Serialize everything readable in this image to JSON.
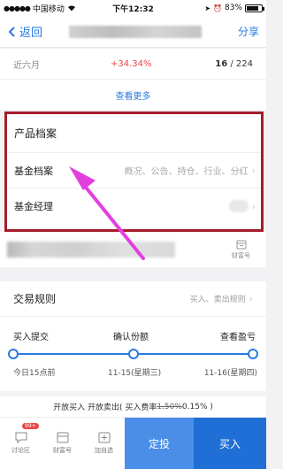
{
  "status": {
    "carrier": "中国移动",
    "time": "下午12:32",
    "battery": "83%",
    "battery_level": 0.83
  },
  "nav": {
    "back_label": "返回",
    "share_label": "分享"
  },
  "performance": {
    "period": "近六月",
    "change": "+34.34%",
    "rank": "16",
    "rank_total": " / 224"
  },
  "more_label": "查看更多",
  "archive": {
    "title": "产品档案",
    "rows": [
      {
        "label": "基金档案",
        "desc": "概况、公告、持仓、行业、分红"
      },
      {
        "label": "基金经理",
        "desc": ""
      }
    ]
  },
  "company": {
    "caifu_label": "财富号"
  },
  "rules": {
    "title": "交易规则",
    "link": "买入、卖出规则",
    "steps": [
      {
        "label": "买入提交",
        "date": "今日15点前"
      },
      {
        "label": "确认份额",
        "date": "11-15(星期三)"
      },
      {
        "label": "查看盈亏",
        "date": "11-16(星期四)"
      }
    ]
  },
  "fee": {
    "prefix": "开放买入 开放卖出( 买入费率 ",
    "old_rate": "1.50%",
    "new_rate": " 0.15% )"
  },
  "bottom": {
    "tools": [
      {
        "label": "讨论区",
        "badge": "99+"
      },
      {
        "label": "财富号"
      },
      {
        "label": "加自选"
      }
    ],
    "ding_label": "定投",
    "buy_label": "买入"
  },
  "colors": {
    "accent": "#2a7ae2",
    "highlight_box": "#a61c2a",
    "arrow": "#e33fe0",
    "up": "#e84646"
  }
}
